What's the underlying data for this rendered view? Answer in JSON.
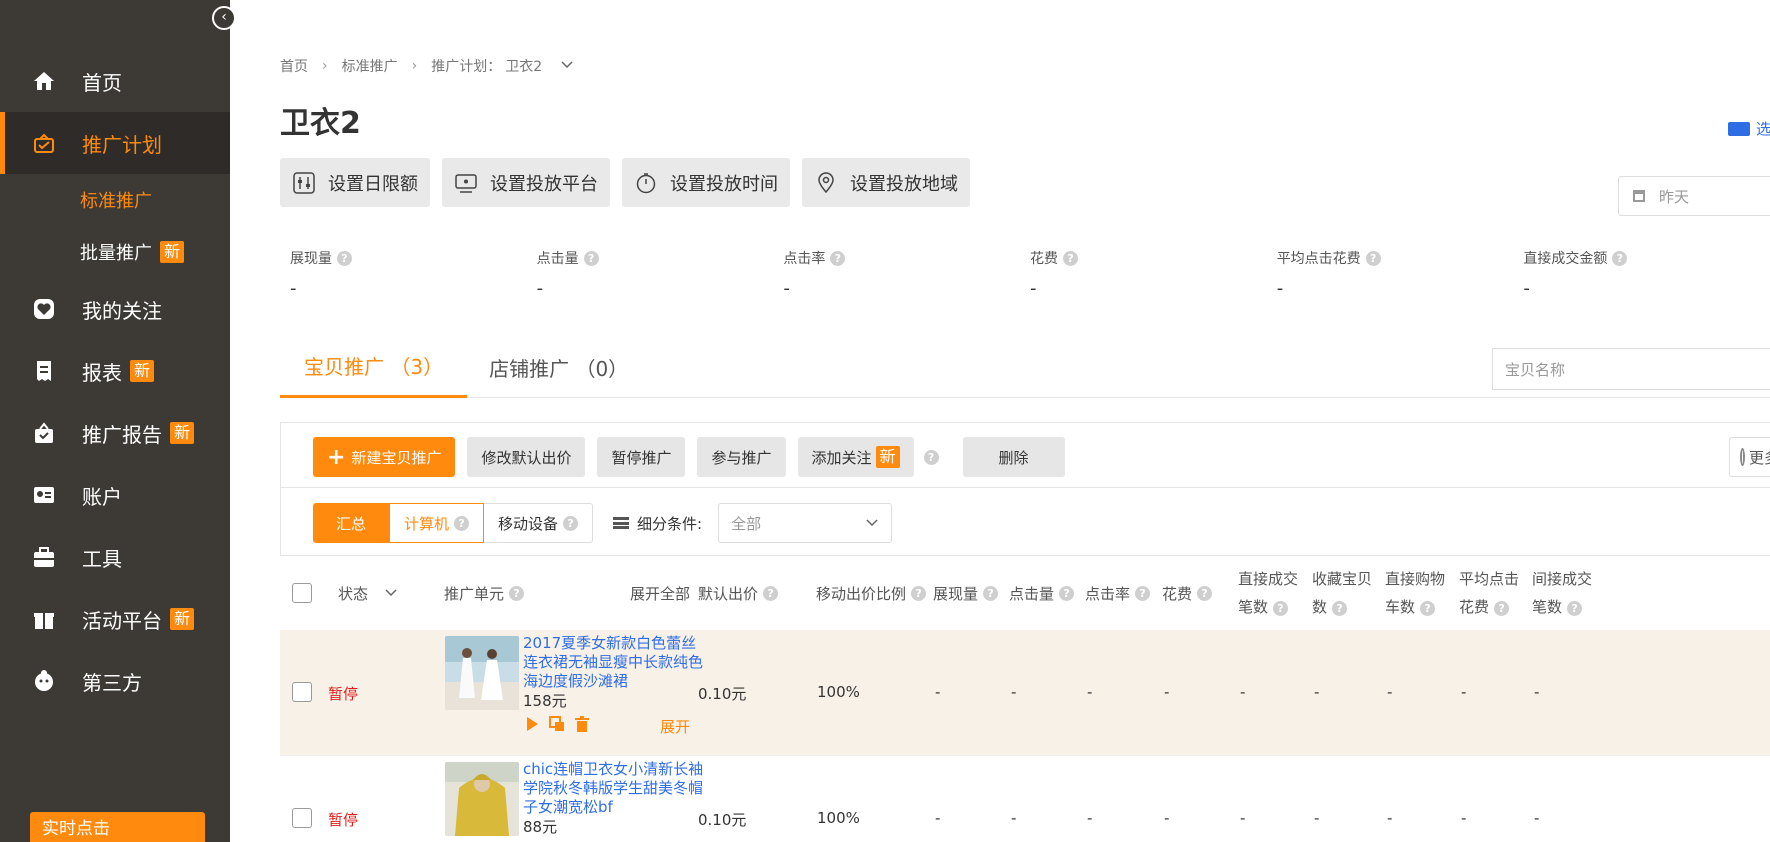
{
  "sidebar": {
    "collapse_icon": "chevron-left-icon",
    "items": [
      {
        "label": "首页",
        "icon": "home-icon"
      },
      {
        "label": "推广计划",
        "icon": "briefcase-icon",
        "active": true
      },
      {
        "label": "我的关注",
        "icon": "heart-icon"
      },
      {
        "label": "报表",
        "icon": "receipt-icon",
        "badge": "新"
      },
      {
        "label": "推广报告",
        "icon": "bag-icon",
        "badge": "新"
      },
      {
        "label": "账户",
        "icon": "id-card-icon"
      },
      {
        "label": "工具",
        "icon": "toolbox-icon"
      },
      {
        "label": "活动平台",
        "icon": "gift-icon",
        "badge": "新"
      },
      {
        "label": "第三方",
        "icon": "avatar-icon"
      }
    ],
    "sub_items": [
      {
        "label": "标准推广",
        "active": true
      },
      {
        "label": "批量推广",
        "badge": "新"
      }
    ],
    "realtime_label": "实时点击"
  },
  "breadcrumb": {
    "home": "首页",
    "level1": "标准推广",
    "plan_label": "推广计划：",
    "plan_name": "卫衣2"
  },
  "page_title": "卫衣2",
  "video_link": "选款",
  "settings": [
    {
      "label": "设置日限额",
      "icon": "sliders-icon"
    },
    {
      "label": "设置投放平台",
      "icon": "monitor-icon"
    },
    {
      "label": "设置投放时间",
      "icon": "stopwatch-icon"
    },
    {
      "label": "设置投放地域",
      "icon": "map-pin-icon"
    }
  ],
  "date_filter": "昨天",
  "metrics": [
    {
      "label": "展现量",
      "value": "-"
    },
    {
      "label": "点击量",
      "value": "-"
    },
    {
      "label": "点击率",
      "value": "-"
    },
    {
      "label": "花费",
      "value": "-"
    },
    {
      "label": "平均点击花费",
      "value": "-"
    },
    {
      "label": "直接成交金额",
      "value": "-"
    }
  ],
  "tabs": [
    {
      "label": "宝贝推广 （3）",
      "active": true
    },
    {
      "label": "店铺推广 （0）"
    }
  ],
  "search_placeholder": "宝贝名称",
  "toolbar": {
    "new": "新建宝贝推广",
    "modify_bid": "修改默认出价",
    "pause": "暂停推广",
    "join": "参与推广",
    "follow": "添加关注",
    "follow_badge": "新",
    "delete": "删除",
    "more_data": "更多数据"
  },
  "device_filter": {
    "summary": "汇总",
    "computer": "计算机",
    "mobile": "移动设备",
    "detail_label": "细分条件:",
    "detail_value": "全部"
  },
  "table": {
    "headers": {
      "status": "状态",
      "unit": "推广单元",
      "expand_all": "展开全部",
      "default_bid": "默认出价",
      "mobile_ratio": "移动出价比例",
      "impressions": "展现量",
      "clicks": "点击量",
      "ctr": "点击率",
      "cost": "花费",
      "direct_deals_1": "直接成交",
      "direct_deals_2": "笔数",
      "fav_items_1": "收藏宝贝",
      "fav_items_2": "数",
      "direct_cart_1": "直接购物",
      "direct_cart_2": "车数",
      "avg_click_1": "平均点击",
      "avg_click_2": "花费",
      "indirect_1": "间接成交",
      "indirect_2": "笔数"
    },
    "rows": [
      {
        "status": "暂停",
        "title": "2017夏季女新款白色蕾丝连衣裙无袖显瘦中长款纯色海边度假沙滩裙",
        "price": "158元",
        "bid": "0.10元",
        "ratio": "100%",
        "expand": "展开",
        "values": [
          "-",
          "-",
          "-",
          "-",
          "-",
          "-",
          "-",
          "-",
          "-"
        ]
      },
      {
        "status": "暂停",
        "title": "chic连帽卫衣女小清新长袖学院秋冬韩版学生甜美冬帽子女潮宽松bf",
        "price": "88元",
        "bid": "0.10元",
        "ratio": "100%",
        "values": [
          "-",
          "-",
          "-",
          "-",
          "-",
          "-",
          "-",
          "-",
          "-"
        ]
      }
    ]
  },
  "colors": {
    "accent": "#ff8a0d",
    "sidebar": "#3d3a36",
    "link": "#2f6de5",
    "status": "#e02020"
  }
}
